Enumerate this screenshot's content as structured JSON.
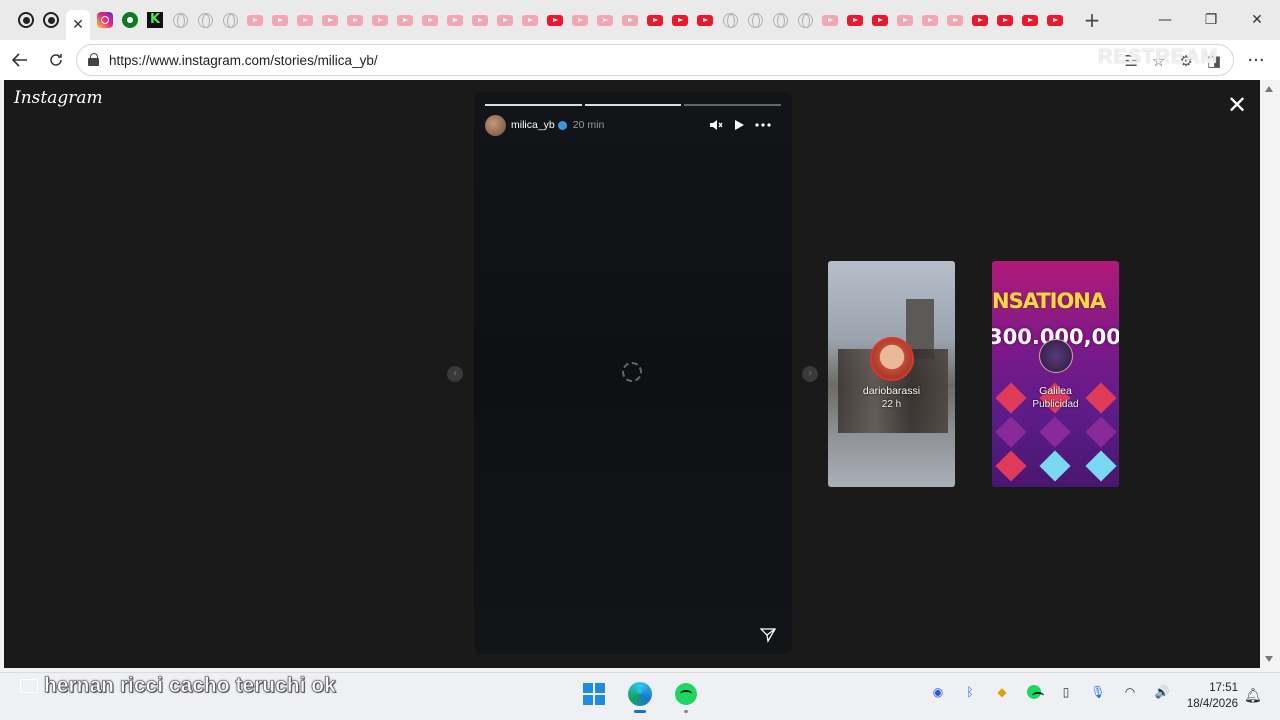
{
  "browser": {
    "url": "https://www.instagram.com/stories/milica_yb/",
    "active_tab_close": "✕",
    "new_tab": "+",
    "window_minimize": "—",
    "window_restore": "❐",
    "window_close": "✕",
    "more": "···",
    "watermark": "RESTREAM"
  },
  "instagram": {
    "logo": "Instagram",
    "close": "✕",
    "story": {
      "username": "milica_yb",
      "time": "20 min",
      "progress": [
        1,
        1,
        0
      ]
    },
    "next_stories": [
      {
        "name": "dariobarassi",
        "sub": "22 h"
      },
      {
        "name": "Galilea",
        "sub": "Publicidad",
        "banner": "NSATIONA",
        "amount": "300.000,00"
      }
    ]
  },
  "taskbar": {
    "caption": "hernan ricci cacho teruchi ok",
    "time": "17:51",
    "date": "18/4/2026"
  },
  "colors": {
    "page_bg": "#1a1a1a",
    "story_bg": "#111317",
    "accent_blue": "#3897f0"
  }
}
